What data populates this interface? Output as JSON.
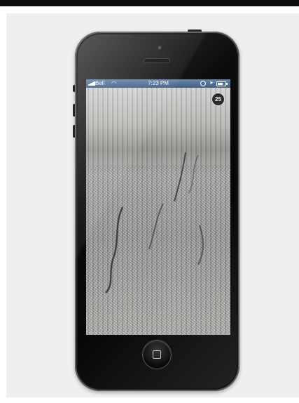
{
  "status_bar": {
    "carrier": "Bell",
    "time": "7:23 PM",
    "icons": [
      "signal-icon",
      "wifi-icon",
      "lock-rotation-icon",
      "location-icon",
      "battery-icon"
    ]
  },
  "camera": {
    "counter_badge": "25"
  },
  "device": {
    "home_icon": "home-button-icon"
  },
  "colors": {
    "status_bar": "#4a6a92",
    "phone_body": "#0c0c0c",
    "backdrop": "#efefef"
  }
}
